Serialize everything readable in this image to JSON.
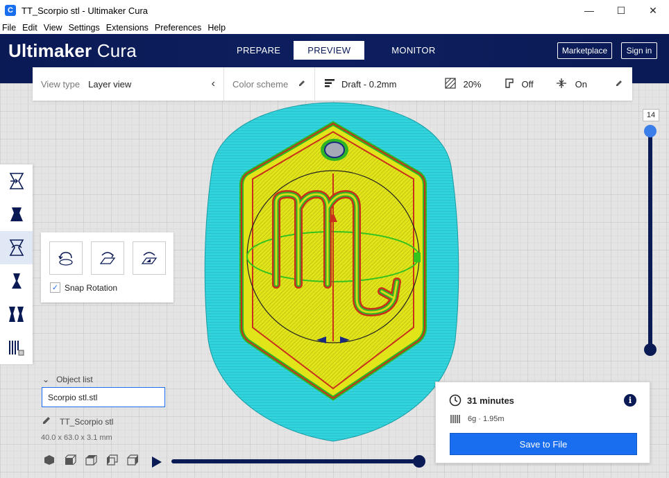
{
  "window": {
    "title": "TT_Scorpio stl - Ultimaker Cura",
    "minimize": "—",
    "maximize": "☐",
    "close": "✕"
  },
  "menu": [
    "File",
    "Edit",
    "View",
    "Settings",
    "Extensions",
    "Preferences",
    "Help"
  ],
  "header": {
    "brand_bold": "Ultimaker",
    "brand_light": "Cura",
    "stages": [
      "PREPARE",
      "PREVIEW",
      "MONITOR"
    ],
    "active_stage": "PREVIEW",
    "marketplace": "Marketplace",
    "signin": "Sign in"
  },
  "viewbar": {
    "view_type_label": "View type",
    "view_type_value": "Layer view",
    "color_scheme_label": "Color scheme",
    "profile": "Draft - 0.2mm",
    "infill": "20%",
    "support": "Off",
    "adhesion": "On"
  },
  "rotate": {
    "snap_label": "Snap Rotation",
    "snap_checked": true
  },
  "object_list": {
    "header": "Object list",
    "field_value": "Scorpio stl.stl",
    "object_name": "TT_Scorpio stl",
    "dimensions": "40.0 x 63.0 x 3.1 mm"
  },
  "layer_slider": {
    "current_layer": "14"
  },
  "print": {
    "time": "31 minutes",
    "material": "6g · 1.95m",
    "save_label": "Save to File"
  },
  "colors": {
    "header_bg": "#0a1a55",
    "accent": "#196ef0",
    "skirt": "#2ad2d8",
    "infill": "#e0e31a",
    "wall_outer": "#c8301c",
    "wall_inner": "#35c21c"
  }
}
